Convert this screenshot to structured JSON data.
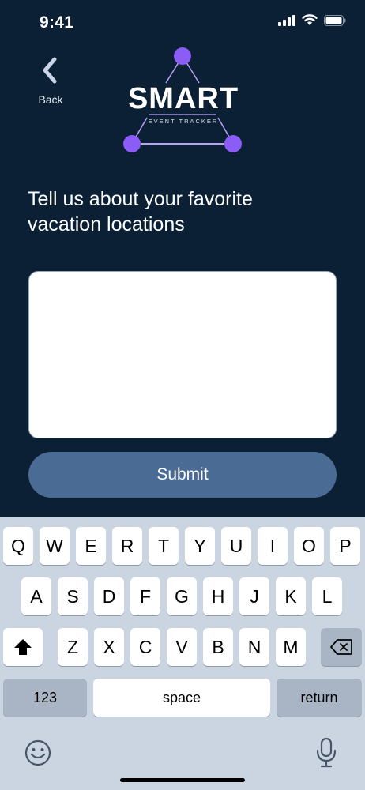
{
  "status_bar": {
    "time": "9:41"
  },
  "nav": {
    "back_label": "Back"
  },
  "logo": {
    "word": "SMART",
    "tagline": "EVENT TRACKER"
  },
  "prompt": {
    "line1": "Tell us about your favorite",
    "line2": "vacation locations"
  },
  "answer": {
    "value": ""
  },
  "submit": {
    "label": "Submit"
  },
  "keyboard": {
    "row1": [
      "Q",
      "W",
      "E",
      "R",
      "T",
      "Y",
      "U",
      "I",
      "O",
      "P"
    ],
    "row2": [
      "A",
      "S",
      "D",
      "F",
      "G",
      "H",
      "J",
      "K",
      "L"
    ],
    "row3": [
      "Z",
      "X",
      "C",
      "V",
      "B",
      "N",
      "M"
    ],
    "numbers_label": "123",
    "space_label": "space",
    "return_label": "return"
  },
  "colors": {
    "background": "#0b2035",
    "accent_purple": "#8b5cf6",
    "button": "#4a6b94",
    "keyboard_bg": "#cbd5e1"
  },
  "icons": [
    "signal-icon",
    "wifi-icon",
    "battery-icon",
    "back-chevron-icon",
    "shift-icon",
    "backspace-icon",
    "emoji-icon",
    "microphone-icon"
  ]
}
